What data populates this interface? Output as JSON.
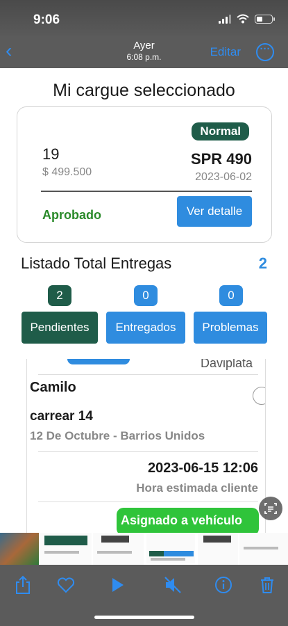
{
  "status_bar": {
    "time": "9:06",
    "signal_bars": 3,
    "battery_level": 0.4
  },
  "nav": {
    "back_icon": "chevron-left-icon",
    "title": "Ayer",
    "subtitle": "6:08 p.m.",
    "edit_label": "Editar",
    "more_icon": "ellipsis-circle-icon"
  },
  "screen": {
    "title": "Mi cargue seleccionado",
    "order": {
      "number": "19",
      "amount": "$ 499.500",
      "priority": "Normal",
      "plate": "SPR 490",
      "date": "2023-06-02",
      "status": "Aprobado",
      "detail_button": "Ver detalle"
    },
    "deliveries": {
      "title": "Listado Total Entregas",
      "total": "2",
      "tabs": [
        {
          "label": "Pendientes",
          "count": "2"
        },
        {
          "label": "Entregados",
          "count": "0"
        },
        {
          "label": "Problemas",
          "count": "0"
        }
      ],
      "previous_item_text": "Daviplata",
      "item": {
        "client": "Camilo",
        "address": "carrear 14",
        "neighborhood": "12 De Octubre - Barrios Unidos",
        "datetime": "2023-06-15 12:06",
        "eta_label": "Hora estimada cliente",
        "assignment": "Asignado a vehículo"
      }
    }
  },
  "colors": {
    "accent_blue": "#2f8cdf",
    "dark_green": "#1f5c49",
    "approved_green": "#2a8a2a",
    "assigned_green": "#2fc43a"
  },
  "toolbar": {
    "icons": [
      "share-icon",
      "heart-icon",
      "play-icon",
      "mute-icon",
      "info-icon",
      "trash-icon"
    ]
  }
}
